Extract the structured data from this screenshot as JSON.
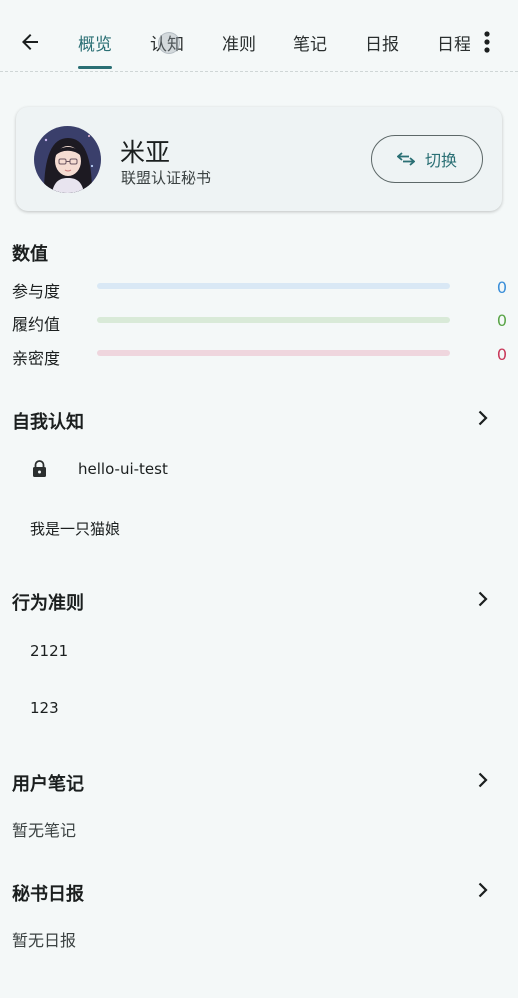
{
  "header": {
    "tabs": [
      {
        "label": "概览",
        "active": true
      },
      {
        "label": "认知",
        "active": false
      },
      {
        "label": "准则",
        "active": false
      },
      {
        "label": "笔记",
        "active": false
      },
      {
        "label": "日报",
        "active": false
      },
      {
        "label": "日程",
        "active": false
      }
    ],
    "accent_color": "#2a6f74"
  },
  "profile": {
    "name": "米亚",
    "role": "联盟认证秘书",
    "switch_label": "切换"
  },
  "stats": {
    "title": "数值",
    "items": [
      {
        "label": "参与度",
        "value": "0",
        "fraction": 0,
        "color": "#3b8fd9",
        "track": "#d9e8f5"
      },
      {
        "label": "履约值",
        "value": "0",
        "fraction": 0,
        "color": "#5aa548",
        "track": "#d9ead8"
      },
      {
        "label": "亲密度",
        "value": "0",
        "fraction": 0,
        "color": "#c9385a",
        "track": "#efd6de"
      }
    ]
  },
  "cognition": {
    "title": "自我认知",
    "items": [
      {
        "text": "hello-ui-test",
        "locked": true
      },
      {
        "text": "我是一只猫娘",
        "locked": false
      }
    ]
  },
  "rules": {
    "title": "行为准则",
    "items": [
      "2121",
      "123"
    ]
  },
  "notes": {
    "title": "用户笔记",
    "empty": "暂无笔记"
  },
  "reports": {
    "title": "秘书日报",
    "empty": "暂无日报"
  }
}
